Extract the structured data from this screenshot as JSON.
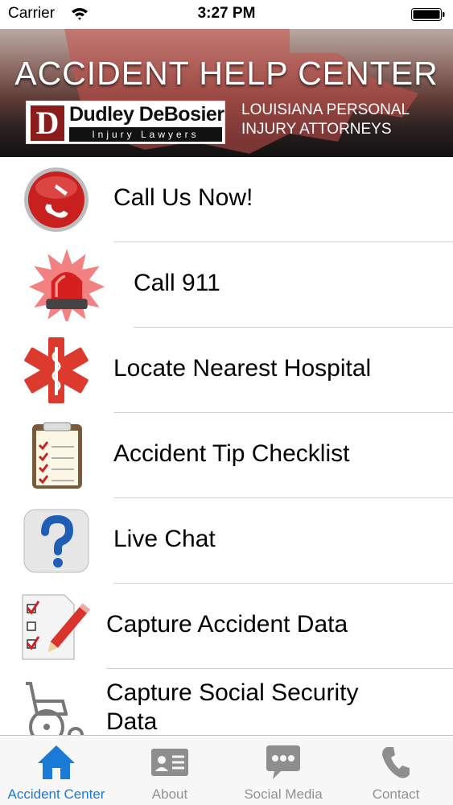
{
  "status_bar": {
    "carrier": "Carrier",
    "time": "3:27 PM"
  },
  "header": {
    "title": "ACCIDENT HELP CENTER",
    "logo_letter": "D",
    "logo_name": "Dudley DeBosier",
    "logo_subtitle": "Injury Lawyers",
    "tagline_line1": "LOUISIANA PERSONAL",
    "tagline_line2": "INJURY ATTORNEYS"
  },
  "menu": {
    "items": [
      {
        "label": "Call Us Now!",
        "icon": "phone-icon"
      },
      {
        "label": "Call 911",
        "icon": "siren-icon"
      },
      {
        "label": "Locate Nearest Hospital",
        "icon": "medical-star-icon"
      },
      {
        "label": "Accident Tip Checklist",
        "icon": "checklist-icon"
      },
      {
        "label": "Live Chat",
        "icon": "help-question-icon"
      },
      {
        "label": "Capture Accident Data",
        "icon": "checklist-pencil-icon"
      },
      {
        "label": "Capture Social Security Data",
        "icon": "wheelchair-icon"
      }
    ],
    "colors": {
      "accent_red": "#d22b2b",
      "separator": "#d2d2d2"
    }
  },
  "tab_bar": {
    "active_color": "#1a7bd6",
    "inactive_color": "#929292",
    "tabs": [
      {
        "label": "Accident Center",
        "icon": "home-icon",
        "active": true
      },
      {
        "label": "About",
        "icon": "contact-card-icon",
        "active": false
      },
      {
        "label": "Social Media",
        "icon": "chat-bubble-icon",
        "active": false
      },
      {
        "label": "Contact",
        "icon": "phone-handset-icon",
        "active": false
      }
    ]
  }
}
